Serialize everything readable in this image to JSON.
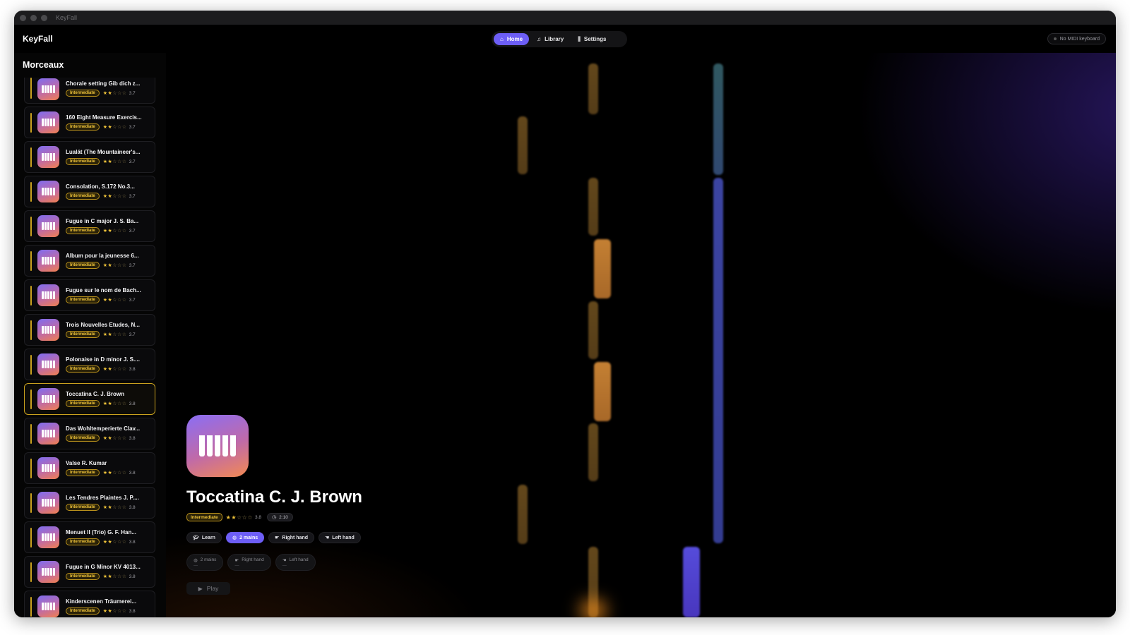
{
  "window": {
    "title": "KeyFall"
  },
  "header": {
    "brand": "KeyFall",
    "nav": [
      {
        "label": "Home",
        "icon": "home-icon",
        "active": true
      },
      {
        "label": "Library",
        "icon": "music-note-icon",
        "active": false
      },
      {
        "label": "Settings",
        "icon": "sliders-icon",
        "active": false
      }
    ],
    "midi_status": "No MIDI keyboard"
  },
  "sidebar": {
    "title": "Morceaux",
    "items": [
      {
        "title": "Chorale setting Gib dich z...",
        "level": "Intermediate",
        "stars": 2,
        "rating": "3.7"
      },
      {
        "title": "160 Eight Measure Exercis...",
        "level": "Intermediate",
        "stars": 2,
        "rating": "3.7"
      },
      {
        "title": "Lualát (The Mountaineer's...",
        "level": "Intermediate",
        "stars": 2,
        "rating": "3.7"
      },
      {
        "title": "Consolation, S.172 No.3...",
        "level": "Intermediate",
        "stars": 2,
        "rating": "3.7"
      },
      {
        "title": "Fugue in C major   J. S. Ba...",
        "level": "Intermediate",
        "stars": 2,
        "rating": "3.7"
      },
      {
        "title": "Album pour la jeunesse   6...",
        "level": "Intermediate",
        "stars": 2,
        "rating": "3.7"
      },
      {
        "title": "Fugue sur le nom de Bach...",
        "level": "Intermediate",
        "stars": 2,
        "rating": "3.7"
      },
      {
        "title": "Trois Nouvelles Etudes, N...",
        "level": "Intermediate",
        "stars": 2,
        "rating": "3.7"
      },
      {
        "title": "Polonaise in D minor   J. S....",
        "level": "Intermediate",
        "stars": 2,
        "rating": "3.8"
      },
      {
        "title": "Toccatina   C. J. Brown",
        "level": "Intermediate",
        "stars": 2,
        "rating": "3.8",
        "selected": true
      },
      {
        "title": "Das Wohltemperierte Clav...",
        "level": "Intermediate",
        "stars": 2,
        "rating": "3.8"
      },
      {
        "title": "Valse   R. Kumar",
        "level": "Intermediate",
        "stars": 2,
        "rating": "3.8"
      },
      {
        "title": "Les Tendres Plaintes   J. P....",
        "level": "Intermediate",
        "stars": 2,
        "rating": "3.8"
      },
      {
        "title": "Menuet II (Trio)   G. F. Han...",
        "level": "Intermediate",
        "stars": 2,
        "rating": "3.8"
      },
      {
        "title": "Fugue in G Minor KV 4013...",
        "level": "Intermediate",
        "stars": 2,
        "rating": "3.8"
      },
      {
        "title": "Kinderscenen   Träumerei...",
        "level": "Intermediate",
        "stars": 2,
        "rating": "3.8"
      }
    ]
  },
  "hero": {
    "title": "Toccatina   C. J. Brown",
    "level": "Intermediate",
    "stars": 2,
    "rating": "3.8",
    "duration": "2:10",
    "modes": [
      {
        "label": "Learn",
        "icon": "graduation-cap-icon",
        "active": false
      },
      {
        "label": "2 mains",
        "icon": "gamepad-icon",
        "active": true
      },
      {
        "label": "Right hand",
        "icon": "right-hand-icon",
        "active": false
      },
      {
        "label": "Left hand",
        "icon": "left-hand-icon",
        "active": false
      }
    ],
    "stats": [
      {
        "label": "2 mains",
        "value": "—",
        "icon": "gamepad-icon"
      },
      {
        "label": "Right hand",
        "value": "—",
        "icon": "right-hand-icon"
      },
      {
        "label": "Left hand",
        "value": "—",
        "icon": "left-hand-icon"
      }
    ],
    "play_label": "Play"
  },
  "colors": {
    "accent": "#6d5ef6",
    "gold": "#f0c43a",
    "background": "#000000"
  }
}
